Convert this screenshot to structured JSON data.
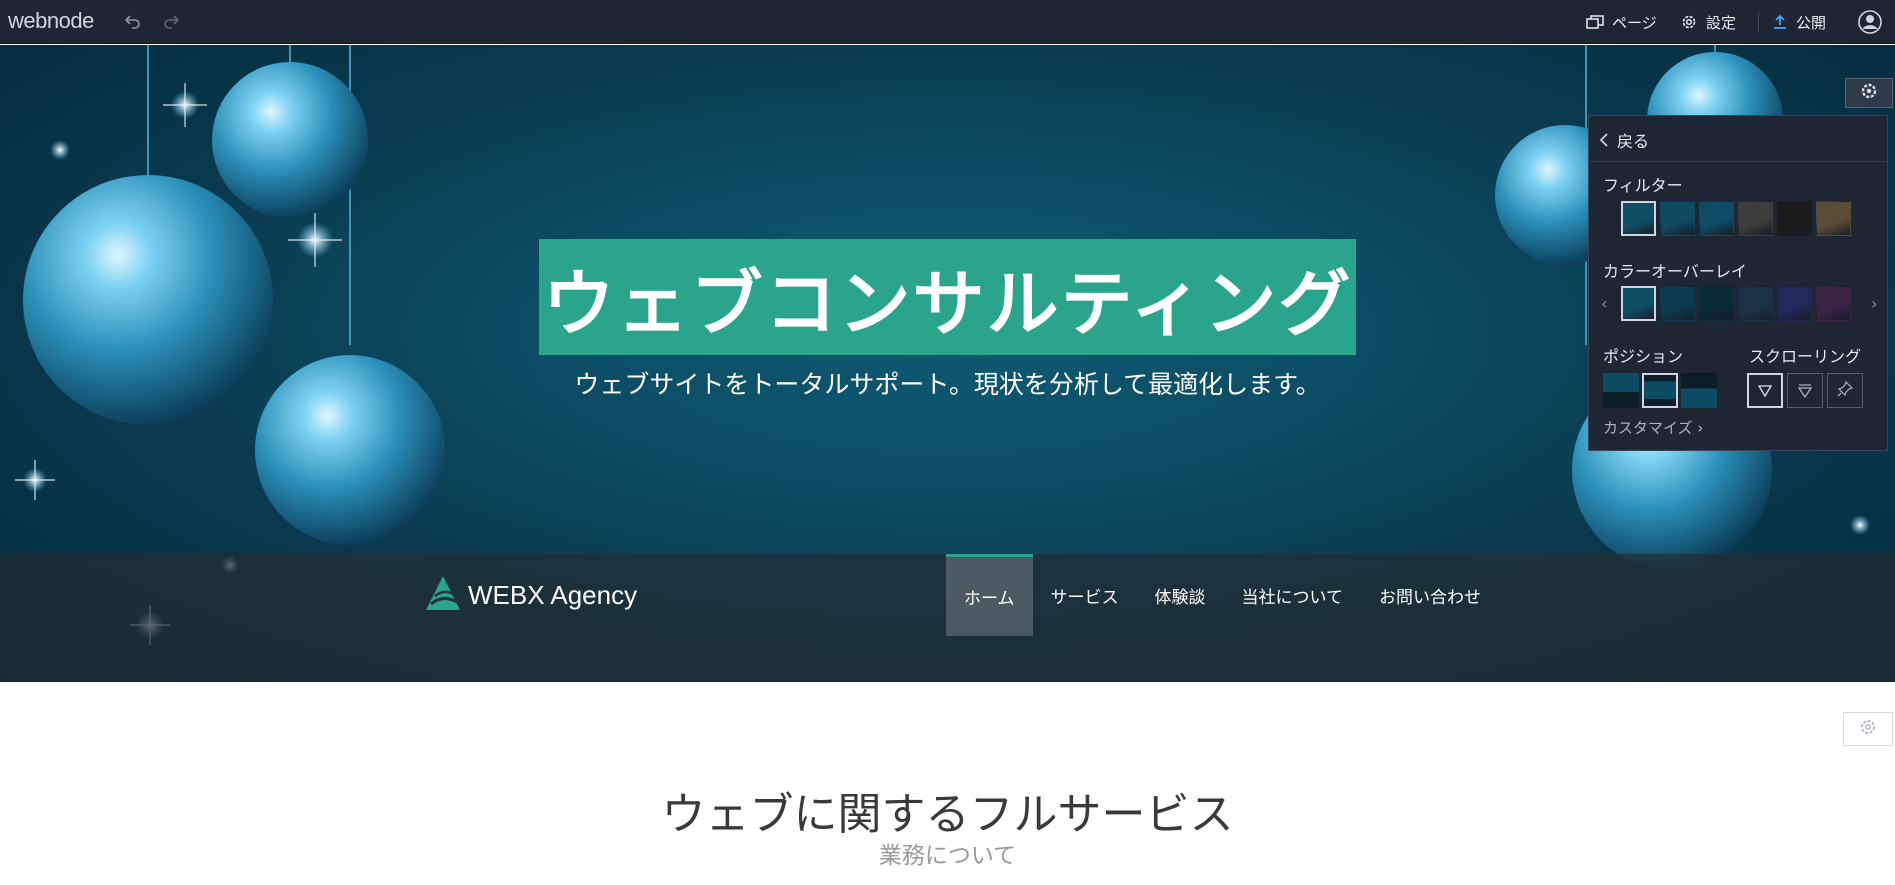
{
  "topbar": {
    "logo": "webnode",
    "pages_label": "ページ",
    "settings_label": "設定",
    "publish_label": "公開",
    "icons": [
      "undo-icon",
      "redo-icon",
      "pages-icon",
      "gear-icon",
      "upload-icon",
      "user-avatar-icon"
    ]
  },
  "hero": {
    "title": "ウェブコンサルティング",
    "subtitle": "ウェブサイトをトータルサポート。現状を分析して最適化します。",
    "title_bg_color": "#2aa58b"
  },
  "site_nav": {
    "brand": "WEBX Agency",
    "menu": [
      {
        "label": "ホーム",
        "active": true
      },
      {
        "label": "サービス",
        "active": false
      },
      {
        "label": "体験談",
        "active": false
      },
      {
        "label": "当社について",
        "active": false
      },
      {
        "label": "お問い合わせ",
        "active": false
      }
    ]
  },
  "panel": {
    "back_label": "戻る",
    "filter_label": "フィルター",
    "filter_swatches": [
      "#0e4d63",
      "#0f4a61",
      "#0d4b66",
      "#3d3d3d",
      "#1a1a1a",
      "#5a4d38"
    ],
    "filter_selected": 0,
    "overlay_label": "カラーオーバーレイ",
    "overlay_swatches": [
      "#0e4d63",
      "#0c3b4f",
      "#0a2a38",
      "#1b3246",
      "#22285a",
      "#3a2446"
    ],
    "overlay_selected": 0,
    "position_label": "ポジション",
    "position_selected": 1,
    "scrolling_label": "スクローリング",
    "scrolling_selected": 0,
    "customize_label": "カスタマイズ"
  },
  "content": {
    "title": "ウェブに関するフルサービス",
    "subtitle": "業務について"
  }
}
